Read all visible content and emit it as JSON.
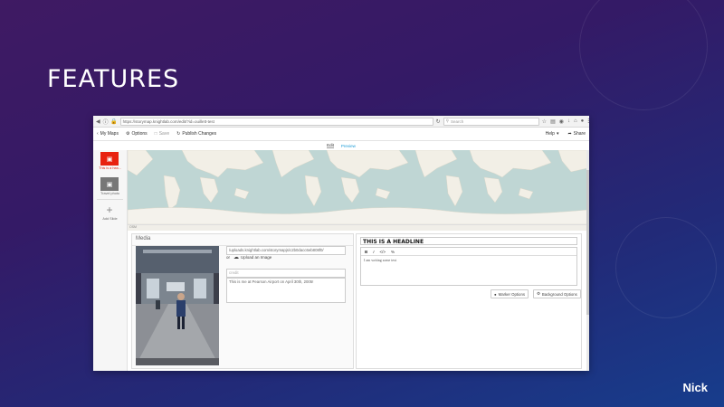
{
  "slide": {
    "title": "FEATURES",
    "presenter": "Nick"
  },
  "browser": {
    "url": "https://storymap.knightlab.com/edit/?id=ouillett-test",
    "search_placeholder": "Search",
    "app_toolbar": {
      "my_maps": "My Maps",
      "options": "Options",
      "save": "Save",
      "publish": "Publish Changes",
      "help": "Help",
      "share": "Share"
    },
    "modes": {
      "edit": "Edit",
      "preview": "Preview"
    },
    "sidebar": {
      "slides": [
        {
          "label": "This is a hea..."
        },
        {
          "label": "Travel photo"
        }
      ],
      "add_label": "Add Slide"
    },
    "map_credit": "OSM",
    "media": {
      "header": "Media",
      "url_value": "/uploads.knightlab.com/storymapjs/c2b0dacc6eb808f0/",
      "upload_or": "or",
      "upload_label": "Upload an Image",
      "credit_placeholder": "credit",
      "caption_value": "This is me at Pearson Airport on April 30th, 2005!"
    },
    "content": {
      "headline": "THIS IS A HEADLINE",
      "body_text": "I am writing some text",
      "rte_bold": "B",
      "rte_italic": "I",
      "rte_code": "</>",
      "rte_link": "%",
      "marker_options": "Marker Options",
      "background_options": "Background Options"
    }
  }
}
